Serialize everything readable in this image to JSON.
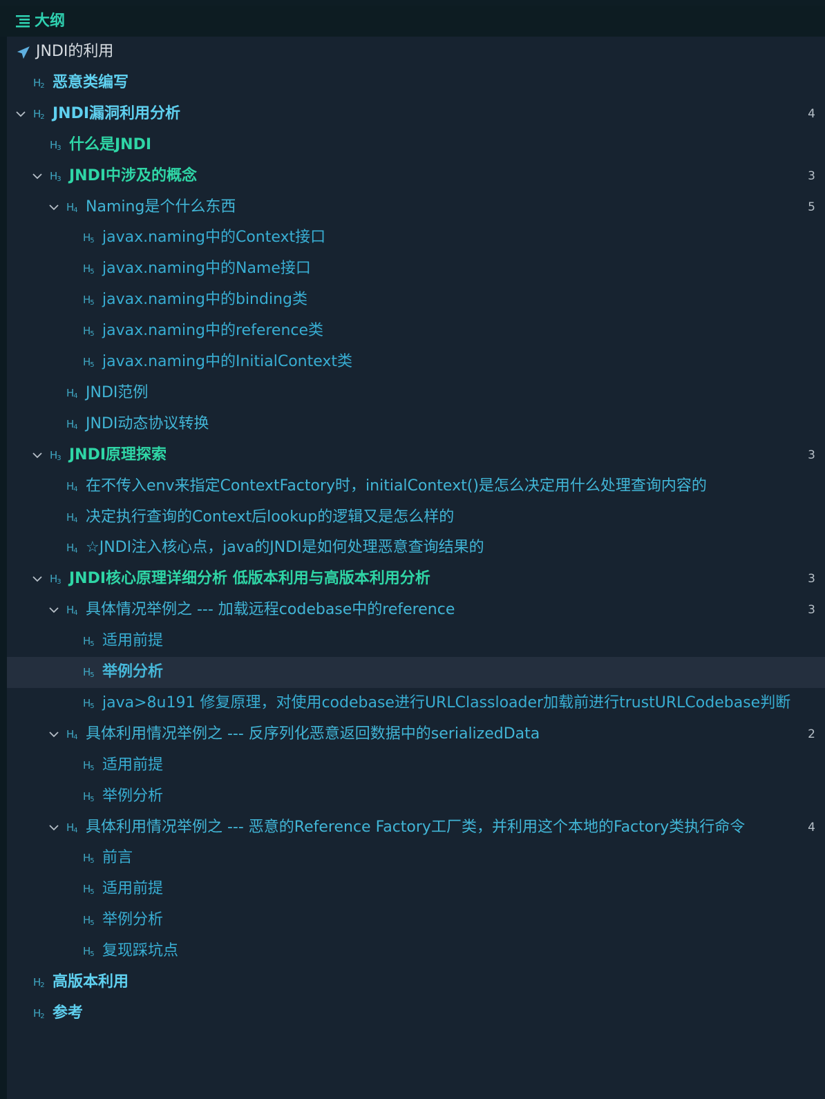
{
  "header": {
    "title": "大纲",
    "icon": "outline-list-icon"
  },
  "colors": {
    "background": "#0c1a21",
    "panel": "#172330",
    "selected_row": "#242f3e",
    "h2": "#5fd0ef",
    "h3": "#2fd6a6",
    "h4": "#41b5d6",
    "h5": "#38aed3",
    "count": "#b7c0c8"
  },
  "outline": {
    "items": [
      {
        "level": 1,
        "badge": "",
        "label": "JNDI的利用",
        "count": "",
        "expanded": false,
        "icon": "plane-icon"
      },
      {
        "level": 2,
        "badge": "H2",
        "label": "恶意类编写",
        "count": ""
      },
      {
        "level": 2,
        "badge": "H2",
        "label": "JNDI漏洞利用分析",
        "count": "4",
        "expanded": true
      },
      {
        "level": 3,
        "badge": "H3",
        "label": "什么是JNDI",
        "count": ""
      },
      {
        "level": 3,
        "badge": "H3",
        "label": "JNDI中涉及的概念",
        "count": "3",
        "expanded": true
      },
      {
        "level": 4,
        "badge": "H4",
        "label": "Naming是个什么东西",
        "count": "5",
        "expanded": true
      },
      {
        "level": 5,
        "badge": "H5",
        "label": "javax.naming中的Context接口",
        "count": ""
      },
      {
        "level": 5,
        "badge": "H5",
        "label": "javax.naming中的Name接口",
        "count": ""
      },
      {
        "level": 5,
        "badge": "H5",
        "label": "javax.naming中的binding类",
        "count": ""
      },
      {
        "level": 5,
        "badge": "H5",
        "label": "javax.naming中的reference类",
        "count": ""
      },
      {
        "level": 5,
        "badge": "H5",
        "label": "javax.naming中的InitialContext类",
        "count": ""
      },
      {
        "level": 4,
        "badge": "H4",
        "label": "JNDI范例",
        "count": ""
      },
      {
        "level": 4,
        "badge": "H4",
        "label": "JNDI动态协议转换",
        "count": ""
      },
      {
        "level": 3,
        "badge": "H3",
        "label": "JNDI原理探索",
        "count": "3",
        "expanded": true
      },
      {
        "level": 4,
        "badge": "H4",
        "label": "在不传入env来指定ContextFactory时，initialContext()是怎么决定用什么处理查询内容的",
        "count": ""
      },
      {
        "level": 4,
        "badge": "H4",
        "label": "决定执行查询的Context后lookup的逻辑又是怎么样的",
        "count": ""
      },
      {
        "level": 4,
        "badge": "H4",
        "label": "☆JNDI注入核心点，java的JNDI是如何处理恶意查询结果的",
        "count": ""
      },
      {
        "level": 3,
        "badge": "H3",
        "label": "JNDI核心原理详细分析 低版本利用与高版本利用分析",
        "count": "3",
        "expanded": true
      },
      {
        "level": 4,
        "badge": "H4",
        "label": "具体情况举例之 --- 加载远程codebase中的reference",
        "count": "3",
        "expanded": true
      },
      {
        "level": 5,
        "badge": "H5",
        "label": "适用前提",
        "count": ""
      },
      {
        "level": 5,
        "badge": "H5",
        "label": "举例分析",
        "count": "",
        "selected": true
      },
      {
        "level": 5,
        "badge": "H5",
        "label": "java>8u191 修复原理，对使用codebase进行URLClassloader加载前进行trustURLCodebase判断",
        "count": ""
      },
      {
        "level": 4,
        "badge": "H4",
        "label": "具体利用情况举例之 --- 反序列化恶意返回数据中的serializedData",
        "count": "2",
        "expanded": true
      },
      {
        "level": 5,
        "badge": "H5",
        "label": "适用前提",
        "count": ""
      },
      {
        "level": 5,
        "badge": "H5",
        "label": "举例分析",
        "count": ""
      },
      {
        "level": 4,
        "badge": "H4",
        "label": "具体利用情况举例之 --- 恶意的Reference Factory工厂类，并利用这个本地的Factory类执行命令",
        "count": "4",
        "expanded": true
      },
      {
        "level": 5,
        "badge": "H5",
        "label": "前言",
        "count": ""
      },
      {
        "level": 5,
        "badge": "H5",
        "label": "适用前提",
        "count": ""
      },
      {
        "level": 5,
        "badge": "H5",
        "label": "举例分析",
        "count": ""
      },
      {
        "level": 5,
        "badge": "H5",
        "label": "复现踩坑点",
        "count": ""
      },
      {
        "level": 2,
        "badge": "H2",
        "label": "高版本利用",
        "count": ""
      },
      {
        "level": 2,
        "badge": "H2",
        "label": "参考",
        "count": ""
      }
    ]
  }
}
